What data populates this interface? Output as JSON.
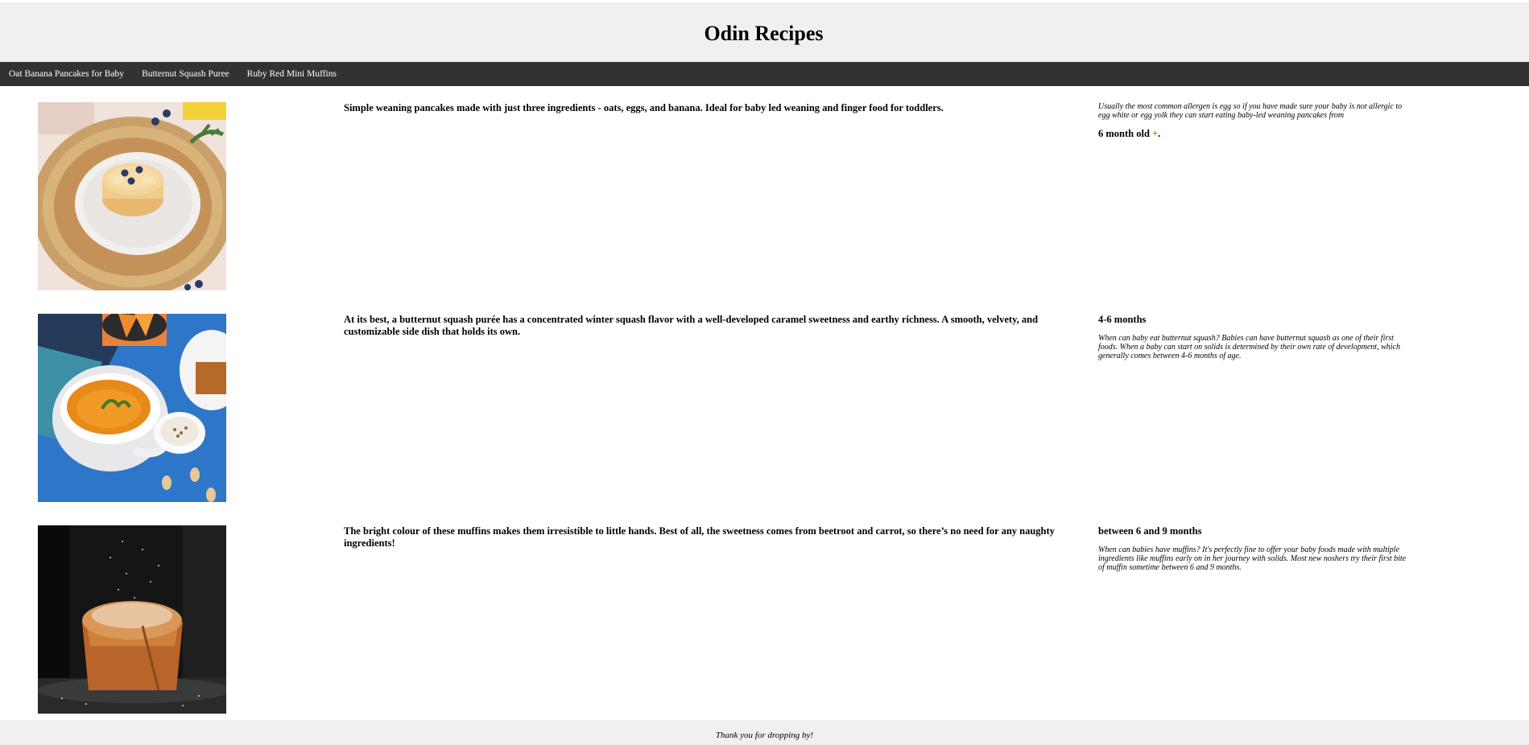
{
  "site": {
    "title": "Odin Recipes"
  },
  "nav": {
    "items": [
      {
        "label": "Oat Banana Pancakes for Baby"
      },
      {
        "label": "Butternut Squash Puree"
      },
      {
        "label": "Ruby Red Mini Muffins"
      }
    ]
  },
  "recipes": [
    {
      "description": "Simple weaning pancakes made with just three ingredients - oats, eggs, and banana. Ideal for baby led weaning and finger food for toddlers.",
      "note": "Usually the most common allergen is egg so if you have made sure your baby is not allergic to egg white or egg yolk they can start eating baby-led weaning pancakes from",
      "age": "6 month old ",
      "age_suffix": "+",
      "age_end": "."
    },
    {
      "description": "At its best, a butternut squash purée has a concentrated winter squash flavor with a well-developed caramel sweetness and earthy richness. A smooth, velvety, and customizable side dish that holds its own.",
      "age": "4-6 months",
      "note": "When can baby eat butternut squash? Babies can have butternut squash as one of their first foods. When a baby can start on solids is determined by their own rate of development, which generally comes between 4-6 months of age."
    },
    {
      "description": "The bright colour of these muffins makes them irresistible to little hands. Best of all, the sweetness comes from beetroot and carrot, so there’s no need for any naughty ingredients!",
      "age": "between 6 and 9 months",
      "note": "When can babies have muffins? It's perfectly fine to offer your baby foods made with multiple ingredients like muffins early on in her journey with solids. Most new noshers try their first bite of muffin sometime between 6 and 9 months."
    }
  ],
  "footer": {
    "text": "Thank you for dropping by!"
  }
}
